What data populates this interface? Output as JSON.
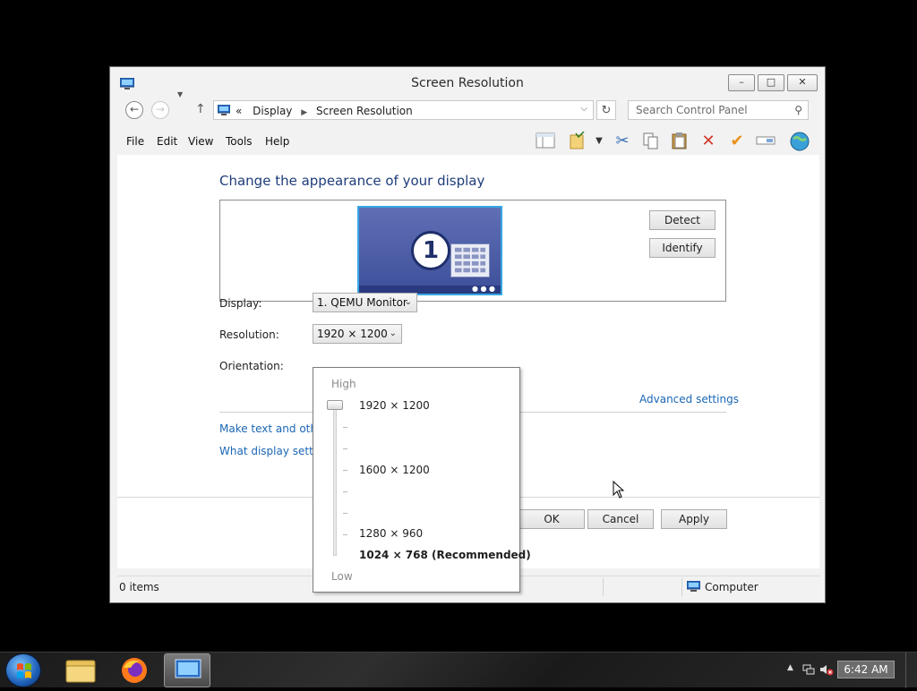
{
  "window": {
    "title": "Screen Resolution",
    "controls": {
      "minimize": "–",
      "maximize": "□",
      "close": "✕"
    }
  },
  "address_bar": {
    "overflow": "«",
    "crumbs": [
      "Display",
      "Screen Resolution"
    ],
    "back_icon": "back-arrow-icon",
    "forward_icon": "forward-arrow-icon"
  },
  "search": {
    "placeholder": "Search Control Panel"
  },
  "menu": {
    "items": [
      "File",
      "Edit",
      "View",
      "Tools",
      "Help"
    ]
  },
  "toolbar_icons": [
    "preview-pane-icon",
    "folder-options-icon",
    "cut-icon",
    "copy-icon",
    "paste-icon",
    "delete-icon",
    "properties-icon",
    "rename-icon",
    "internet-icon"
  ],
  "content": {
    "heading": "Change the appearance of your display",
    "monitor_number": "1",
    "detect_label": "Detect",
    "identify_label": "Identify",
    "display_label": "Display:",
    "display_value": "1. QEMU Monitor",
    "resolution_label": "Resolution:",
    "resolution_value": "1920 × 1200",
    "orientation_label": "Orientation:",
    "advanced_link": "Advanced settings",
    "link1": "Make text and other",
    "link2": "What display setting",
    "ok_label": "OK",
    "cancel_label": "Cancel",
    "apply_label": "Apply"
  },
  "resolution_popup": {
    "high_label": "High",
    "low_label": "Low",
    "options": [
      "1920 × 1200",
      "1600 × 1200",
      "1280 × 960",
      "1024 × 768 (Recommended)"
    ],
    "selected": "1920 × 1200"
  },
  "statusbar": {
    "items_text": "0 items",
    "location": "Computer"
  },
  "taskbar": {
    "clock": "6:42 AM",
    "apps": [
      "file-explorer",
      "firefox",
      "screen-resolution"
    ]
  }
}
